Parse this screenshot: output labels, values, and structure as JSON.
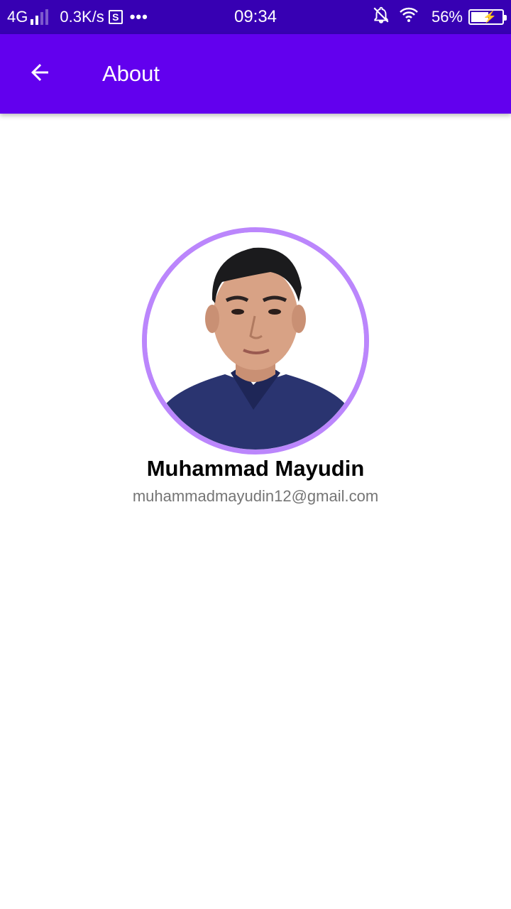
{
  "status_bar": {
    "network": "4G",
    "speed": "0.3K/s",
    "s_badge": "S",
    "more": "•••",
    "time": "09:34",
    "battery": "56%",
    "icons": [
      "signal-icon",
      "s-app-icon",
      "more-dots-icon",
      "notifications-off-icon",
      "wifi-icon",
      "battery-charging-icon"
    ],
    "battery_level": 0.56
  },
  "app_bar": {
    "title": "About",
    "back_icon": "arrow-back-icon",
    "color": "#6200EE"
  },
  "profile": {
    "name": "Muhammad Mayudin",
    "email": "muhammadmayudin12@gmail.com",
    "avatar_ring_color": "#BB86FC"
  }
}
